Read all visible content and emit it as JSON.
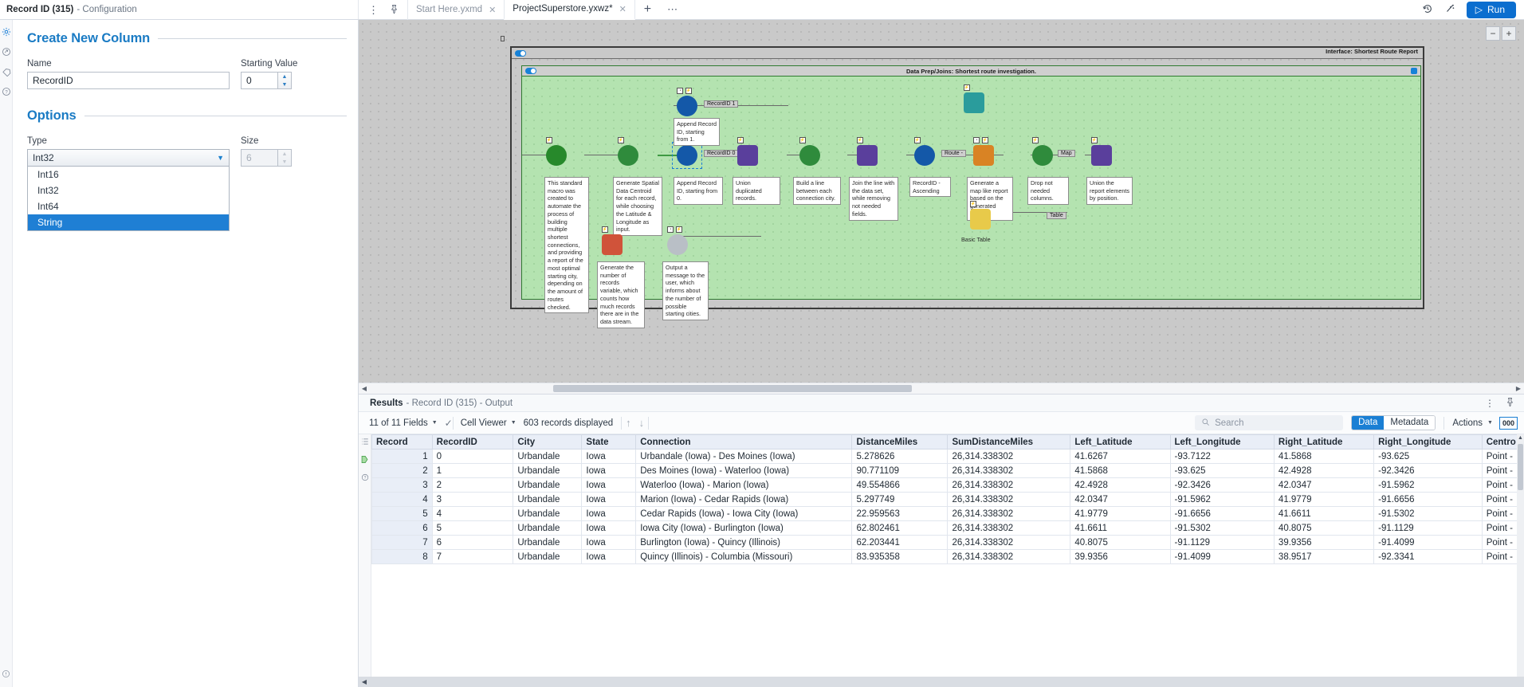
{
  "config_panel": {
    "title": "Record ID (315)",
    "subtitle": "- Configuration",
    "section1_title": "Create New Column",
    "name_label": "Name",
    "name_value": "RecordID",
    "starting_value_label": "Starting Value",
    "starting_value": "0",
    "section2_title": "Options",
    "type_label": "Type",
    "type_value": "Int32",
    "type_options": [
      "Int16",
      "Int32",
      "Int64",
      "String"
    ],
    "type_selected_option": "String",
    "size_label": "Size",
    "size_value": "6"
  },
  "topbar": {
    "tabs": [
      {
        "label": "Start Here.yxmd",
        "active": false
      },
      {
        "label": "ProjectSuperstore.yxwz*",
        "active": true
      }
    ],
    "add_tab": "+",
    "more_tabs": "⋯",
    "kebab": "⋮",
    "pin": "📌",
    "history_icon": "↺",
    "magic_icon": "✦",
    "run_label": "Run",
    "run_icon": "▷",
    "accent": "#0b6ecf"
  },
  "canvas": {
    "zoom_out": "−",
    "zoom_in": "+",
    "outer_container_title": "Interface: Shortest Route Report",
    "inner_container_title": "Data Prep/Joins: Shortest route investigation.",
    "connection_labels": [
      "RecordID 1",
      "RecordID 0",
      "Route -",
      "Map",
      "Table"
    ],
    "annotations": [
      "Append Record ID, starting from 1.",
      "This standard macro was created to automate the process of building multiple shortest connections, and providing a report of the most optimal starting city, depending on the amount of routes checked.",
      "Generate Spatial Data Centroid for each record, while choosing the Latitude & Longitude as input.",
      "Append Record ID, starting from 0.",
      "Union duplicated records.",
      "Build a line between each connection city.",
      "Join the line with the data set, while removing not needed fields.",
      "RecordID - Ascending",
      "Generate a map like report based on the generated route.",
      "Drop not needed columns.",
      "Union the report elements by position.",
      "Generate the number of records variable, which counts how much records there are in the data stream.",
      "Output a message to the user, which informs about the number of possible starting cities.",
      "Basic Table"
    ]
  },
  "results": {
    "title": "Results",
    "subtitle": "- Record ID (315) - Output",
    "kebab": "⋮",
    "pin": "📌",
    "fields_label": "11 of 11 Fields",
    "check_icon": "✓",
    "cell_viewer_label": "Cell Viewer",
    "records_label": "603 records displayed",
    "up_arrow": "↑",
    "down_arrow": "↓",
    "search_placeholder": "Search",
    "search_icon": "⚲",
    "segments": [
      {
        "label": "Data",
        "active": true
      },
      {
        "label": "Metadata",
        "active": false
      }
    ],
    "actions_label": "Actions",
    "zero_badge": "000",
    "columns": [
      "Record",
      "RecordID",
      "City",
      "State",
      "Connection",
      "DistanceMiles",
      "SumDistanceMiles",
      "Left_Latitude",
      "Left_Longitude",
      "Right_Latitude",
      "Right_Longitude",
      "Centro"
    ],
    "rows": [
      [
        "1",
        "0",
        "Urbandale",
        "Iowa",
        "Urbandale (Iowa) - Des Moines (Iowa)",
        "5.278626",
        "26,314.338302",
        "41.6267",
        "-93.7122",
        "41.5868",
        "-93.625",
        "Point -"
      ],
      [
        "2",
        "1",
        "Urbandale",
        "Iowa",
        "Des Moines (Iowa) - Waterloo (Iowa)",
        "90.771109",
        "26,314.338302",
        "41.5868",
        "-93.625",
        "42.4928",
        "-92.3426",
        "Point -"
      ],
      [
        "3",
        "2",
        "Urbandale",
        "Iowa",
        "Waterloo (Iowa) - Marion (Iowa)",
        "49.554866",
        "26,314.338302",
        "42.4928",
        "-92.3426",
        "42.0347",
        "-91.5962",
        "Point -"
      ],
      [
        "4",
        "3",
        "Urbandale",
        "Iowa",
        "Marion (Iowa) - Cedar Rapids (Iowa)",
        "5.297749",
        "26,314.338302",
        "42.0347",
        "-91.5962",
        "41.9779",
        "-91.6656",
        "Point -"
      ],
      [
        "5",
        "4",
        "Urbandale",
        "Iowa",
        "Cedar Rapids (Iowa) - Iowa City (Iowa)",
        "22.959563",
        "26,314.338302",
        "41.9779",
        "-91.6656",
        "41.6611",
        "-91.5302",
        "Point -"
      ],
      [
        "6",
        "5",
        "Urbandale",
        "Iowa",
        "Iowa City (Iowa) - Burlington (Iowa)",
        "62.802461",
        "26,314.338302",
        "41.6611",
        "-91.5302",
        "40.8075",
        "-91.1129",
        "Point -"
      ],
      [
        "7",
        "6",
        "Urbandale",
        "Iowa",
        "Burlington (Iowa) - Quincy (Illinois)",
        "62.203441",
        "26,314.338302",
        "40.8075",
        "-91.1129",
        "39.9356",
        "-91.4099",
        "Point -"
      ],
      [
        "8",
        "7",
        "Urbandale",
        "Iowa",
        "Quincy (Illinois) - Columbia (Missouri)",
        "83.935358",
        "26,314.338302",
        "39.9356",
        "-91.4099",
        "38.9517",
        "-92.3341",
        "Point -"
      ]
    ]
  }
}
